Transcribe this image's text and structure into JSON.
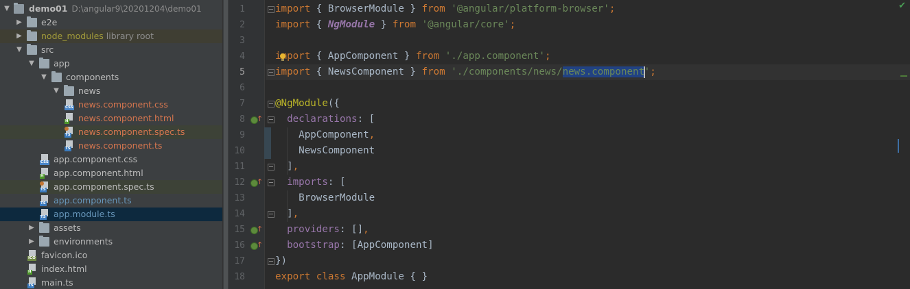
{
  "project_tree": {
    "root": {
      "name": "demo01",
      "path": "D:\\angular9\\20201204\\demo01"
    },
    "items": [
      {
        "label": "e2e",
        "type": "folder",
        "depth": 1,
        "expanded": false
      },
      {
        "label": "node_modules",
        "type": "folder",
        "depth": 1,
        "expanded": false,
        "note": "library root"
      },
      {
        "label": "src",
        "type": "folder",
        "depth": 1,
        "expanded": true
      },
      {
        "label": "app",
        "type": "folder",
        "depth": 2,
        "expanded": true
      },
      {
        "label": "components",
        "type": "folder",
        "depth": 3,
        "expanded": true
      },
      {
        "label": "news",
        "type": "folder",
        "depth": 4,
        "expanded": true
      },
      {
        "label": "news.component.css",
        "type": "css",
        "depth": 5
      },
      {
        "label": "news.component.html",
        "type": "html",
        "depth": 5
      },
      {
        "label": "news.component.spec.ts",
        "type": "ts",
        "depth": 5
      },
      {
        "label": "news.component.ts",
        "type": "ts",
        "depth": 5
      },
      {
        "label": "app.component.css",
        "type": "css",
        "depth": 3
      },
      {
        "label": "app.component.html",
        "type": "html",
        "depth": 3
      },
      {
        "label": "app.component.spec.ts",
        "type": "ts",
        "depth": 3
      },
      {
        "label": "app.component.ts",
        "type": "ts",
        "depth": 3
      },
      {
        "label": "app.module.ts",
        "type": "ts",
        "depth": 3,
        "selected": true
      },
      {
        "label": "assets",
        "type": "folder",
        "depth": 2,
        "expanded": false
      },
      {
        "label": "environments",
        "type": "folder",
        "depth": 2,
        "expanded": false
      },
      {
        "label": "favicon.ico",
        "type": "ico",
        "depth": 2
      },
      {
        "label": "index.html",
        "type": "html",
        "depth": 2
      },
      {
        "label": "main.ts",
        "type": "ts",
        "depth": 2
      }
    ],
    "file_tags": {
      "css": "CSS",
      "html": "H",
      "ts": "TS",
      "ico": "ICO"
    }
  },
  "editor": {
    "line_numbers": [
      "1",
      "2",
      "3",
      "4",
      "5",
      "6",
      "7",
      "8",
      "9",
      "10",
      "11",
      "12",
      "13",
      "14",
      "15",
      "16",
      "17",
      "18"
    ],
    "lines": [
      [
        [
          "kw",
          "import"
        ],
        [
          "p",
          " { BrowserModule } "
        ],
        [
          "kw",
          "from"
        ],
        [
          "p",
          " "
        ],
        [
          "str",
          "'@angular/platform-browser'"
        ],
        [
          "kw",
          ";"
        ]
      ],
      [
        [
          "kw",
          "import"
        ],
        [
          "p",
          " { "
        ],
        [
          "ng",
          "NgModule"
        ],
        [
          "p",
          " } "
        ],
        [
          "kw",
          "from"
        ],
        [
          "p",
          " "
        ],
        [
          "str",
          "'@angular/core'"
        ],
        [
          "kw",
          ";"
        ]
      ],
      [],
      [
        [
          "kw",
          "import"
        ],
        [
          "p",
          " { AppComponent } "
        ],
        [
          "kw",
          "from"
        ],
        [
          "p",
          " "
        ],
        [
          "str",
          "'./app.component'"
        ],
        [
          "kw",
          ";"
        ]
      ],
      [
        [
          "kw",
          "import"
        ],
        [
          "p",
          " { NewsComponent } "
        ],
        [
          "kw",
          "from"
        ],
        [
          "p",
          " "
        ],
        [
          "str",
          "'./components/news/"
        ],
        [
          "sel",
          "news.component"
        ],
        [
          "caret",
          ""
        ],
        [
          "str",
          "'"
        ],
        [
          "kw",
          ";"
        ]
      ],
      [],
      [
        [
          "ann",
          "@NgModule"
        ],
        [
          "p",
          "({"
        ]
      ],
      [
        [
          "p",
          "  "
        ],
        [
          "prop",
          "declarations"
        ],
        [
          "p",
          ": ["
        ]
      ],
      [
        [
          "p",
          "    AppComponent"
        ],
        [
          "kw",
          ","
        ]
      ],
      [
        [
          "p",
          "    NewsComponent"
        ]
      ],
      [
        [
          "p",
          "  ]"
        ],
        [
          "kw",
          ","
        ]
      ],
      [
        [
          "p",
          "  "
        ],
        [
          "prop",
          "imports"
        ],
        [
          "p",
          ": ["
        ]
      ],
      [
        [
          "p",
          "    BrowserModule"
        ]
      ],
      [
        [
          "p",
          "  ]"
        ],
        [
          "kw",
          ","
        ]
      ],
      [
        [
          "p",
          "  "
        ],
        [
          "prop",
          "providers"
        ],
        [
          "p",
          ": []"
        ],
        [
          "kw",
          ","
        ]
      ],
      [
        [
          "p",
          "  "
        ],
        [
          "prop",
          "bootstrap"
        ],
        [
          "p",
          ": [AppComponent]"
        ]
      ],
      [
        [
          "p",
          "})"
        ]
      ],
      [
        [
          "kw",
          "export class"
        ],
        [
          "p",
          " AppModule { }"
        ]
      ]
    ],
    "current_line": 5,
    "override_marker_lines": [
      8,
      12,
      15,
      16
    ],
    "fold_marker_lines": [
      1,
      5,
      7,
      8,
      11,
      12,
      14,
      17
    ],
    "changed_lines": [
      9,
      10
    ],
    "inspection_status": "✔",
    "colors": {
      "keyword": "#cc7832",
      "string": "#6a8759",
      "annotation": "#bbb529",
      "property": "#9876aa",
      "text": "#a9b7c6",
      "selection": "#214283"
    }
  }
}
